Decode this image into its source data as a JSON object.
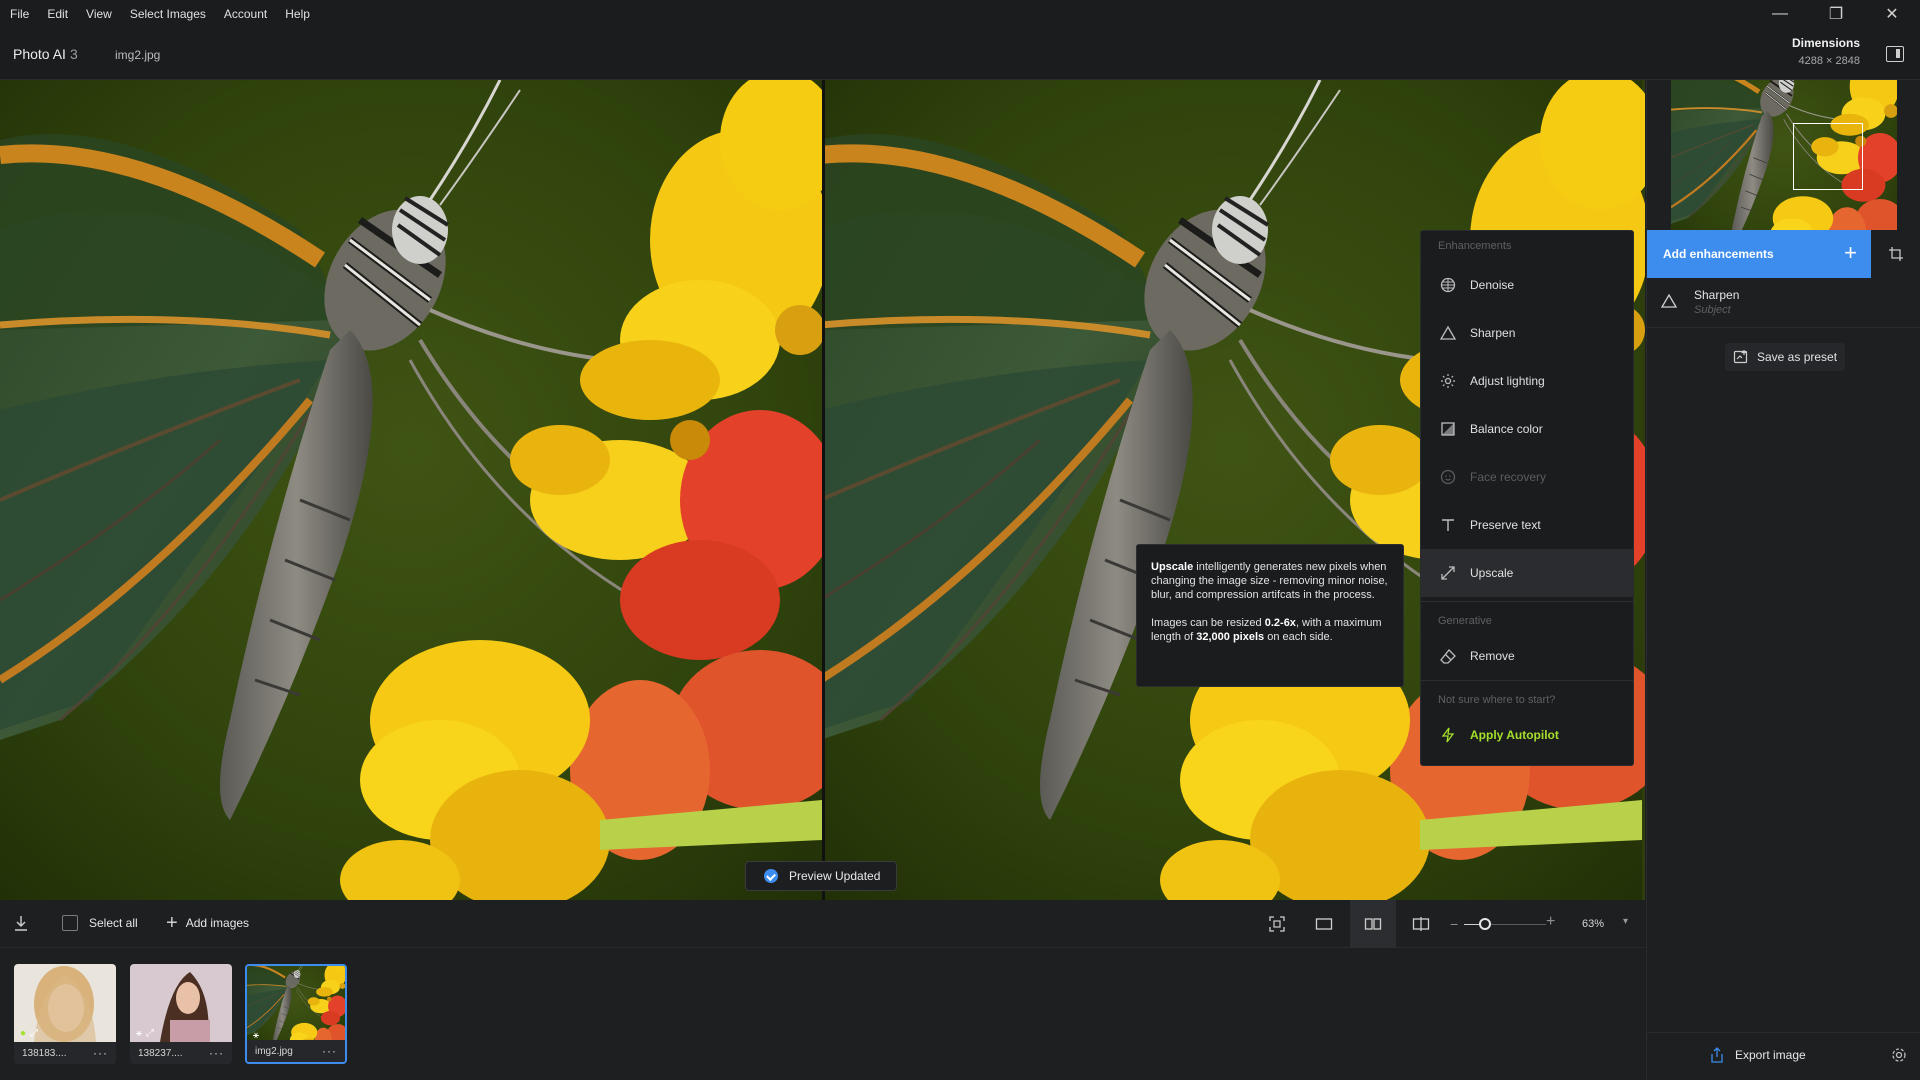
{
  "menubar": {
    "items": [
      "File",
      "Edit",
      "View",
      "Select Images",
      "Account",
      "Help"
    ]
  },
  "window_controls": {
    "minimize": "—",
    "restore": "❐",
    "close": "✕"
  },
  "header": {
    "app_name": "Photo AI",
    "app_version": "3",
    "file_name": "img2.jpg",
    "dimensions_label": "Dimensions",
    "dimensions_value": "4288 × 2848"
  },
  "canvas": {
    "toast": "Preview Updated"
  },
  "tooltip": {
    "title": "Upscale",
    "line1": " intelligently generates new pixels when changing the image size - removing minor noise, blur, and compression artifcats in the process.",
    "line2_a": "Images can be resized ",
    "line2_b": "0.2-6x",
    "line2_c": ", with a maximum length of ",
    "line2_d": "32,000 pixels",
    "line2_e": " on each side."
  },
  "enhancements_menu": {
    "section_enhancements": "Enhancements",
    "items": [
      {
        "label": "Denoise",
        "icon": "denoise-icon",
        "state": "enabled"
      },
      {
        "label": "Sharpen",
        "icon": "triangle-icon",
        "state": "enabled"
      },
      {
        "label": "Adjust lighting",
        "icon": "sun-icon",
        "state": "enabled"
      },
      {
        "label": "Balance color",
        "icon": "balance-icon",
        "state": "enabled"
      },
      {
        "label": "Face recovery",
        "icon": "face-icon",
        "state": "disabled"
      },
      {
        "label": "Preserve text",
        "icon": "text-icon",
        "state": "enabled"
      },
      {
        "label": "Upscale",
        "icon": "upscale-icon",
        "state": "hovered"
      }
    ],
    "section_generative": "Generative",
    "generative_items": [
      {
        "label": "Remove",
        "icon": "eraser-icon"
      }
    ],
    "section_autopilot": "Not sure where to start?",
    "autopilot_label": "Apply Autopilot",
    "accent": "#a5e02c"
  },
  "right_panel": {
    "add_enhancements": "Add enhancements",
    "applied": {
      "name": "Sharpen",
      "sub": "Subject"
    },
    "save_preset": "Save as preset",
    "export": "Export image",
    "accent": "#3c8dee"
  },
  "toolbar": {
    "select_all": "Select all",
    "add_images": "Add images",
    "zoom_value": "63%",
    "zoom_fraction": 0.25
  },
  "filmstrip": {
    "items": [
      {
        "caption": "138183....",
        "selected": false
      },
      {
        "caption": "138237....",
        "selected": false
      },
      {
        "caption": "img2.jpg",
        "selected": true
      }
    ]
  }
}
